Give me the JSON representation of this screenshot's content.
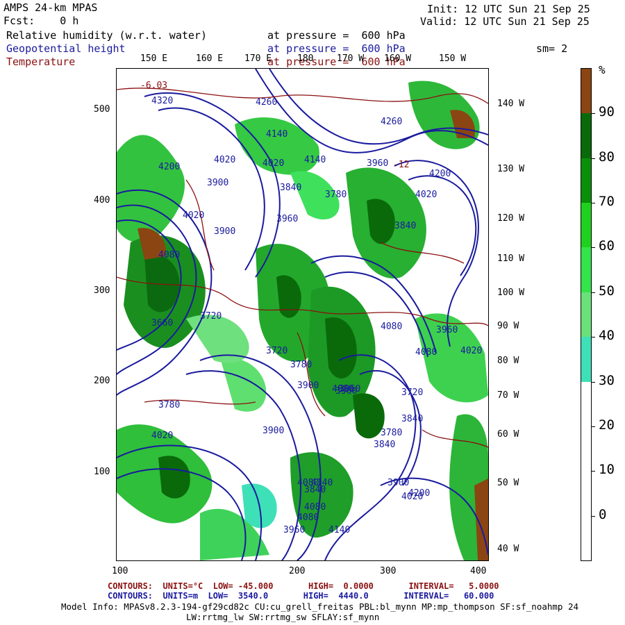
{
  "header": {
    "model": "AMPS 24-km MPAS",
    "fcst": "Fcst:    0 h",
    "init": "Init: 12 UTC Sun 21 Sep 25",
    "valid": "Valid: 12 UTC Sun 21 Sep 25"
  },
  "fields": [
    {
      "name": "Relative humidity (w.r.t. water)",
      "level": "at pressure =  600 hPa",
      "color": "#000000"
    },
    {
      "name": "Geopotential height",
      "level": "at pressure =  600 hPa",
      "color": "#1a1a9e"
    },
    {
      "name": "Temperature",
      "level": "at pressure =  600 hPa",
      "color": "#8b1010"
    }
  ],
  "smoothing": "sm= 2",
  "top_lon_labels": [
    "150 E",
    "160 E",
    "170 E",
    "180",
    "170 W",
    "160 W",
    "150 W"
  ],
  "right_lon_labels": [
    "140 W",
    "130 W",
    "120 W",
    "110 W",
    "100 W",
    "90 W",
    "80 W",
    "70 W",
    "60 W",
    "50 W",
    "40 W"
  ],
  "x_ticks": [
    "100",
    "200",
    "300",
    "400"
  ],
  "y_ticks": [
    "500",
    "400",
    "300",
    "200",
    "100"
  ],
  "height_labels": [
    "4320",
    "4260",
    "4140",
    "4200",
    "4020",
    "4140",
    "4260",
    "4200",
    "3900",
    "4020",
    "3840",
    "3780",
    "4020",
    "4080",
    "3960",
    "3840",
    "3900",
    "4020",
    "3720",
    "3660",
    "3780",
    "4080",
    "3720",
    "3780",
    "3960",
    "3900",
    "4020",
    "4080",
    "3960",
    "3780",
    "3840",
    "3720",
    "3900",
    "4020",
    "3840",
    "3900",
    "3960",
    "4080",
    "3840",
    "4200",
    "4080",
    "4140",
    "4020",
    "3960",
    "4080",
    "4080",
    "3960",
    "4140"
  ],
  "temp_labels": [
    "-6.03",
    "-12"
  ],
  "colorbar": {
    "unit": "%",
    "labels": [
      "90",
      "80",
      "70",
      "60",
      "50",
      "40",
      "30",
      "20",
      "10",
      "0"
    ],
    "colors": [
      "#8b4513",
      "#0a6a0a",
      "#0a8f0a",
      "#1fd11f",
      "#33e44a",
      "#6be07a",
      "#3ee0b8",
      "#ffffff",
      "#ffffff",
      "#ffffff",
      "#ffffff"
    ]
  },
  "footer": {
    "temp_contours": "CONTOURS:  UNITS=°C  LOW= -45.000       HIGH=  0.0000       INTERVAL=   5.0000",
    "height_contours": "CONTOURS:  UNITS=m  LOW=  3540.0       HIGH=  4440.0       INTERVAL=   60.000",
    "model_info": "Model Info: MPASv8.2.3-194-gf29cd82c CU:cu_grell_freitas PBL:bl_mynn MP:mp_thompson SF:sf_noahmp 24",
    "model_info2": "LW:rrtmg_lw SW:rrtmg_sw SFLAY:sf_mynn"
  }
}
